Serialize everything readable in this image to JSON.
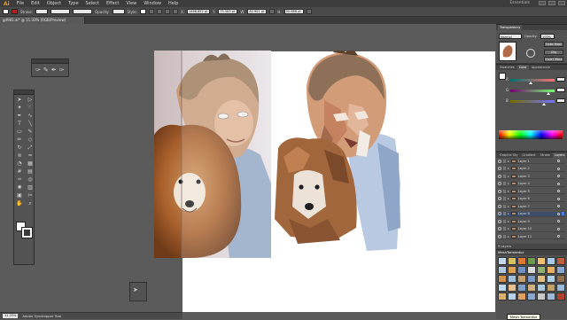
{
  "app": {
    "logo": "Ai",
    "workspace": "Essentials"
  },
  "menu": {
    "items": [
      "File",
      "Edit",
      "Object",
      "Type",
      "Select",
      "Effect",
      "View",
      "Window",
      "Help"
    ]
  },
  "control": {
    "stroke_label": "Stroke:",
    "opacity_label": "Opacity:",
    "style_label": "Style:",
    "x_label": "X:",
    "x_value": "1466.852 pt",
    "y_label": "Y:",
    "y_value": "75.583 pt",
    "w_label": "W:",
    "w_value": "82.901 pt",
    "h_label": "H:",
    "h_value": "50.688 pt",
    "fill_color": "#ffffff",
    "stroke_color": "#b02020"
  },
  "document_tab": {
    "title": "gd981.ai* @ 11.33% (RGB/Preview)"
  },
  "status": {
    "zoom": "11.33%",
    "tool": "Adobe Eyedropper Tool"
  },
  "colors": {
    "accent": "#f7931e",
    "selection": "#3d4d6a"
  },
  "panels": {
    "transparency": {
      "tabs": [
        "Transparency"
      ],
      "blend_mode": "Normal",
      "opacity_label": "Opacity:",
      "opacity_value": "100%",
      "make_mask": "Make Mask",
      "clip": "Clip",
      "invert_mask": "Invert Mask"
    },
    "color": {
      "tabs": [
        "Swatches",
        "Color",
        "Appearance"
      ],
      "channels": [
        "R",
        "G",
        "B"
      ],
      "levels": [
        0.45,
        0.85,
        0.75
      ]
    },
    "layers": {
      "tabs": [
        "Graphic Sty",
        "Gradient",
        "Stroke",
        "Layers"
      ],
      "layers": [
        {
          "name": "Layer 1",
          "selected": false
        },
        {
          "name": "Layer 2",
          "selected": false
        },
        {
          "name": "Layer 3",
          "selected": false
        },
        {
          "name": "Layer 4",
          "selected": false
        },
        {
          "name": "Layer 5",
          "selected": false
        },
        {
          "name": "Layer 6",
          "selected": false
        },
        {
          "name": "Layer 7",
          "selected": false
        },
        {
          "name": "Layer 8",
          "selected": true
        },
        {
          "name": "Layer 9",
          "selected": false
        },
        {
          "name": "Layer 10",
          "selected": false
        },
        {
          "name": "Layer 11",
          "selected": false
        }
      ],
      "footer": "9 Layers"
    },
    "mesh": {
      "title": "MeshTormentor",
      "tooltip": "Mesh Tormentor",
      "tile_colors": [
        "#c4d8ec",
        "#d8c060",
        "#e07a30",
        "#6a9a4a",
        "#f2c070",
        "#a8c8e8",
        "#c06040",
        "#b0c8e0",
        "#e0a050",
        "#7090c0",
        "#d8d8d8",
        "#90b070",
        "#e8b060",
        "#8aa8d0",
        "#d09050",
        "#a0c0e0",
        "#c8a070",
        "#7a9ac8",
        "#e0c080",
        "#b0d0e8",
        "#907050",
        "#c0d8f0",
        "#e8c090",
        "#80a0c8",
        "#d0b080",
        "#a8c8e0",
        "#c0a068",
        "#98b8d8",
        "#d8b070",
        "#b8d0e8",
        "#e0a060",
        "#88a8d0",
        "#c8c8c8",
        "#a0b8d8",
        "#b04030"
      ]
    }
  },
  "tools": {
    "icons": [
      "arrow-icon",
      "direct-select-icon",
      "magic-wand-icon",
      "lasso-icon",
      "pen-icon",
      "curvature-icon",
      "type-icon",
      "line-icon",
      "rectangle-icon",
      "paintbrush-icon",
      "pencil-icon",
      "eraser-icon",
      "rotate-icon",
      "scale-icon",
      "width-icon",
      "warp-icon",
      "shape-builder-icon",
      "perspective-icon",
      "mesh-icon",
      "gradient-icon",
      "eyedropper-icon",
      "blend-icon",
      "symbol-sprayer-icon",
      "graph-icon",
      "artboard-icon",
      "slice-icon",
      "hand-icon",
      "zoom-icon"
    ],
    "glyphs": [
      "➤",
      "▷",
      "✦",
      "➰",
      "✒",
      "∿",
      "T",
      "╲",
      "▭",
      "✎",
      "✏",
      "◇",
      "↻",
      "⤢",
      "≋",
      "≈",
      "◔",
      "▦",
      "#",
      "▤",
      "✑",
      "◎",
      "✺",
      "▥",
      "▣",
      "✂",
      "✋",
      "⌕"
    ]
  },
  "small_panel": {
    "glyphs": [
      "✑",
      "✎",
      "✒",
      "✑"
    ]
  },
  "float_panel": {
    "glyph": "➤"
  }
}
